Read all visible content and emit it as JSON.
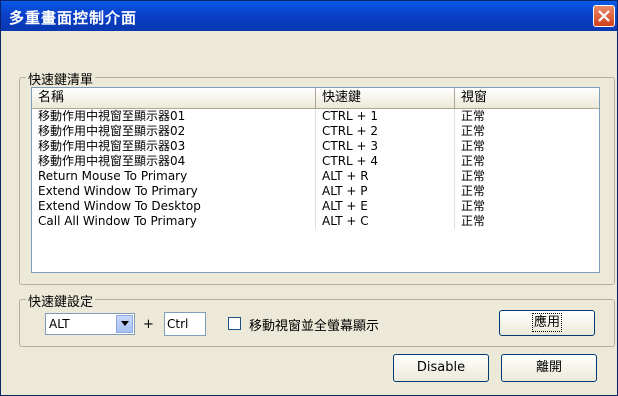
{
  "window": {
    "title": "多重畫面控制介面"
  },
  "hotkey_list": {
    "group_label": "快速鍵清單",
    "columns": [
      "名稱",
      "快速鍵",
      "視窗"
    ],
    "rows": [
      {
        "name": "移動作用中視窗至顯示器01",
        "hotkey": "CTRL + 1",
        "window": "正常"
      },
      {
        "name": "移動作用中視窗至顯示器02",
        "hotkey": "CTRL + 2",
        "window": "正常"
      },
      {
        "name": "移動作用中視窗至顯示器03",
        "hotkey": "CTRL + 3",
        "window": "正常"
      },
      {
        "name": "移動作用中視窗至顯示器04",
        "hotkey": "CTRL + 4",
        "window": "正常"
      },
      {
        "name": "Return Mouse To Primary",
        "hotkey": "ALT + R",
        "window": "正常"
      },
      {
        "name": "Extend Window To Primary",
        "hotkey": "ALT + P",
        "window": "正常"
      },
      {
        "name": "Extend Window To Desktop",
        "hotkey": "ALT + E",
        "window": "正常"
      },
      {
        "name": "Call All Window To Primary",
        "hotkey": "ALT + C",
        "window": "正常"
      }
    ]
  },
  "hotkey_settings": {
    "group_label": "快速鍵設定",
    "modifier_selected": "ALT",
    "plus": "+",
    "key_value": "Ctrl",
    "checkbox_label": "移動視窗並全螢幕顯示",
    "checkbox_checked": false,
    "apply_label": "應用"
  },
  "footer": {
    "disable_label": "Disable",
    "close_label": "離開"
  }
}
